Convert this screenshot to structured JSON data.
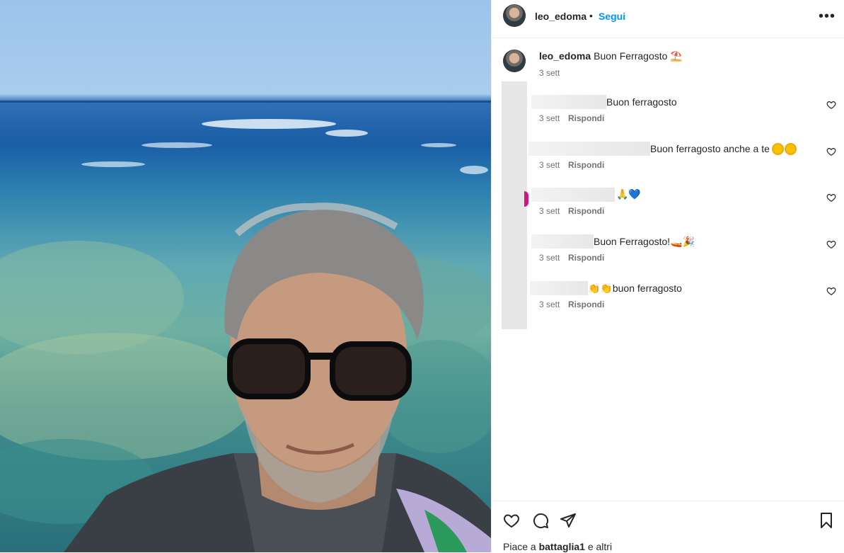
{
  "post": {
    "username": "leo_edoma",
    "separator": "•",
    "follow_label": "Segui",
    "more_icon": "more-horizontal-icon",
    "caption": {
      "username": "leo_edoma",
      "text": "Buon Ferragosto ⛱️",
      "time": "3 sett"
    }
  },
  "comments": [
    {
      "text": "Buon ferragosto",
      "time": "3 sett",
      "reply_label": "Rispondi"
    },
    {
      "text": "Buon ferragosto anche a te",
      "time": "3 sett",
      "reply_label": "Rispondi"
    },
    {
      "text": "🙏💙",
      "time": "3 sett",
      "reply_label": "Rispondi"
    },
    {
      "text": "Buon Ferragosto!🚤🎉",
      "time": "3 sett",
      "reply_label": "Rispondi"
    },
    {
      "text": "👏👏buon ferragosto",
      "time": "3 sett",
      "reply_label": "Rispondi"
    }
  ],
  "footer": {
    "likes_prefix": "Piace a ",
    "likes_user": "battaglia1",
    "likes_suffix": " e altri"
  },
  "colors": {
    "accent": "#0095f6",
    "text": "#262626",
    "muted": "#737373",
    "story_ring": "#d3157f"
  }
}
